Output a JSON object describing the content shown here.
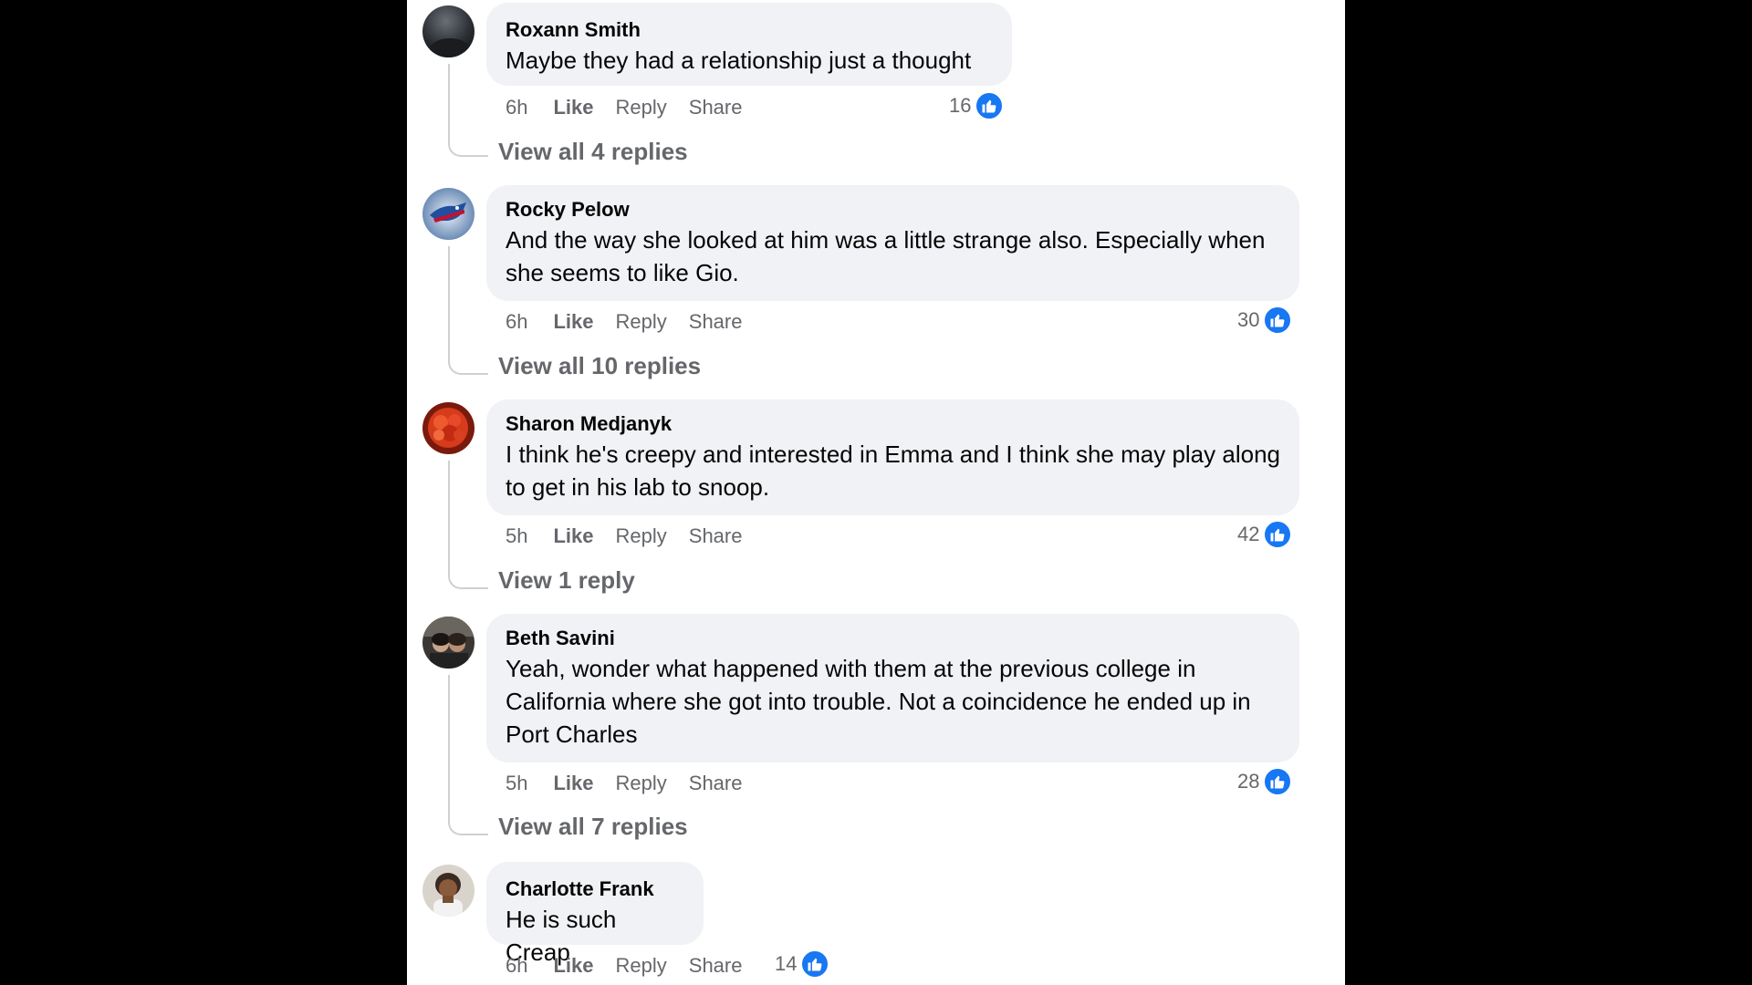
{
  "colors": {
    "background": "#000000",
    "panel": "#ffffff",
    "bubble": "#f0f2f5",
    "secondary_text": "#65676b",
    "like_blue": "#1877f2"
  },
  "comments": [
    {
      "author": "Roxann Smith",
      "text": "Maybe they had a relationship just a thought",
      "time": "6h",
      "like_label": "Like",
      "reply_label": "Reply",
      "share_label": "Share",
      "reaction_count": "16",
      "reaction_icon": "thumbs-up-icon",
      "view_replies": "View all 4 replies"
    },
    {
      "author": "Rocky Pelow",
      "text": "And the way she looked at him was a little strange also. Especially when she seems to like Gio.",
      "time": "6h",
      "like_label": "Like",
      "reply_label": "Reply",
      "share_label": "Share",
      "reaction_count": "30",
      "reaction_icon": "thumbs-up-icon",
      "view_replies": "View all 10 replies"
    },
    {
      "author": "Sharon Medjanyk",
      "text": "I think he's creepy and interested in Emma and I think she may play along to get in his lab to snoop.",
      "time": "5h",
      "like_label": "Like",
      "reply_label": "Reply",
      "share_label": "Share",
      "reaction_count": "42",
      "reaction_icon": "thumbs-up-icon",
      "view_replies": "View 1 reply"
    },
    {
      "author": "Beth Savini",
      "text": "Yeah, wonder what happened with them at the previous college in California where she got into trouble. Not a coincidence he ended up in Port Charles",
      "time": "5h",
      "like_label": "Like",
      "reply_label": "Reply",
      "share_label": "Share",
      "reaction_count": "28",
      "reaction_icon": "thumbs-up-icon",
      "view_replies": "View all 7 replies"
    },
    {
      "author": "Charlotte Frank",
      "text": "He is such Creap",
      "time": "6h",
      "like_label": "Like",
      "reply_label": "Reply",
      "share_label": "Share",
      "reaction_count": "14",
      "reaction_icon": "thumbs-up-icon"
    }
  ]
}
